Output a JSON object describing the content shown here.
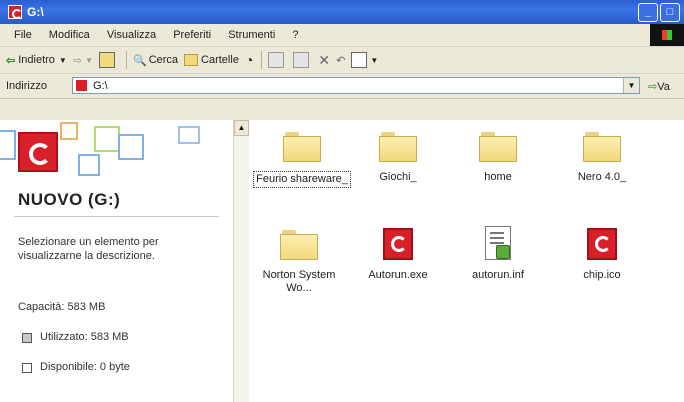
{
  "window": {
    "title": "G:\\"
  },
  "menu": [
    "File",
    "Modifica",
    "Visualizza",
    "Preferiti",
    "Strumenti",
    "?"
  ],
  "toolbar": {
    "back": "Indietro",
    "search": "Cerca",
    "folders": "Cartelle"
  },
  "address": {
    "label": "Indirizzo",
    "value": "G:\\",
    "go": "Va"
  },
  "left_panel": {
    "title": "NUOVO (G:)",
    "description": "Selezionare un elemento per visualizzarne la descrizione.",
    "capacity": "Capacità: 583 MB",
    "used": "Utilizzato: 583 MB",
    "free": "Disponibile: 0 byte"
  },
  "items": [
    {
      "label": "Feurio shareware_",
      "type": "folder"
    },
    {
      "label": "Giochi_",
      "type": "folder"
    },
    {
      "label": "home",
      "type": "folder"
    },
    {
      "label": "Nero 4.0_",
      "type": "folder"
    },
    {
      "label": "Norton System Wo...",
      "type": "folder"
    },
    {
      "label": "Autorun.exe",
      "type": "red-file"
    },
    {
      "label": "autorun.inf",
      "type": "inf-file"
    },
    {
      "label": "chip.ico",
      "type": "red-file"
    }
  ]
}
